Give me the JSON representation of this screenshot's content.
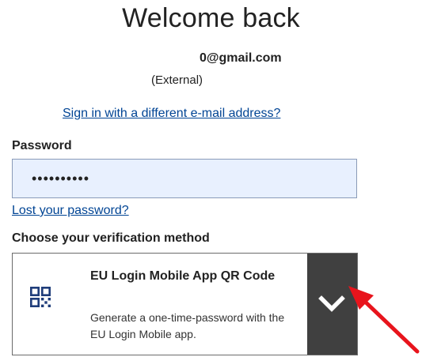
{
  "header": {
    "title": "Welcome back",
    "email": "0@gmail.com",
    "account_type": "(External)"
  },
  "links": {
    "different_email": "Sign in with a different e-mail address?",
    "lost_password": "Lost your password?"
  },
  "password": {
    "label": "Password",
    "value": "••••••••••"
  },
  "verification": {
    "label": "Choose your verification method",
    "selected_method": {
      "title": "EU Login Mobile App QR Code",
      "description": "Generate a one-time-password with the EU Login Mobile app.",
      "icon": "qr-code-icon"
    },
    "dropdown_icon": "chevron-down-icon"
  },
  "annotation": {
    "icon": "red-arrow-icon",
    "color": "#e8141c"
  },
  "colors": {
    "link": "#004494",
    "input_bg": "#e8f0fe",
    "dropdown_bg": "#404040",
    "qr_icon": "#1f3d7a"
  }
}
